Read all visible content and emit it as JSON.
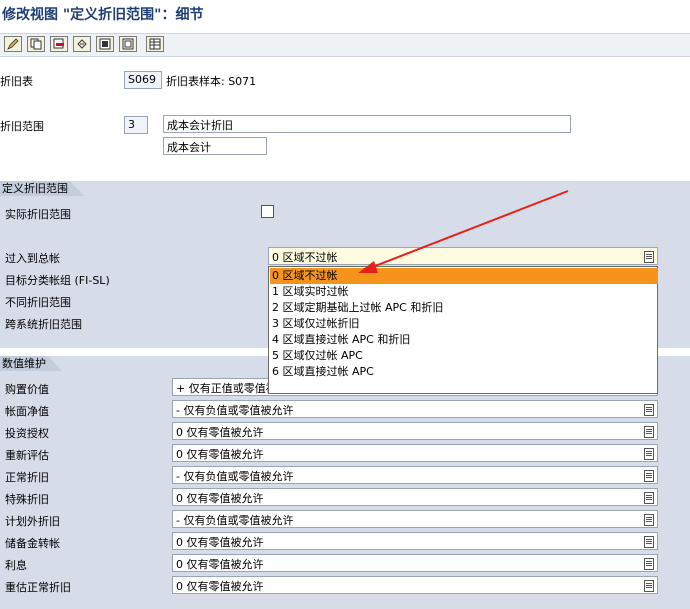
{
  "window": {
    "title": "修改视图 \"定义折旧范围\"：细节"
  },
  "toolbar": {
    "icons": [
      "edit-icon",
      "copy-icon",
      "delete-icon",
      "undo-icon",
      "select-all-icon",
      "deselect-all-icon",
      "table-icon"
    ]
  },
  "header": {
    "chart_label": "折旧表",
    "chart_value": "S069",
    "chart_desc": "折旧表样本: S071",
    "area_label": "折旧范围",
    "area_value": "3",
    "area_name": "成本会计折旧",
    "area_short": "成本会计"
  },
  "section_define": {
    "title": "定义折旧范围",
    "real_area_label": "实际折旧范围",
    "real_area_checked": false,
    "posting_label": "过入到总帐",
    "posting_value": "0 区域不过帐",
    "target_group_label": "目标分类帐组 (FI-SL)",
    "diff_area_label": "不同折旧范围",
    "cross_system_label": "跨系统折旧范围"
  },
  "dropdown": {
    "selected_index": 0,
    "options": [
      "0 区域不过帐",
      "1 区域实时过帐",
      "2 区域定期基础上过帐 APC 和折旧",
      "3 区域仅过帐折旧",
      "4 区域直接过帐 APC 和折旧",
      "5 区域仅过帐 APC",
      "6 区域直接过帐 APC"
    ]
  },
  "section_values": {
    "title": "数值维护",
    "rows": [
      {
        "label": "购置价值",
        "value": "+ 仅有正值或零值被允许"
      },
      {
        "label": "帐面净值",
        "value": "- 仅有负值或零值被允许"
      },
      {
        "label": "投资授权",
        "value": "0 仅有零值被允许"
      },
      {
        "label": "重新评估",
        "value": "0 仅有零值被允许"
      },
      {
        "label": "正常折旧",
        "value": "- 仅有负值或零值被允许"
      },
      {
        "label": "特殊折旧",
        "value": "0 仅有零值被允许"
      },
      {
        "label": "计划外折旧",
        "value": "- 仅有负值或零值被允许"
      },
      {
        "label": "储备金转帐",
        "value": "0 仅有零值被允许"
      },
      {
        "label": "利息",
        "value": "0 仅有零值被允许"
      },
      {
        "label": "重估正常折旧",
        "value": "0 仅有零值被允许"
      }
    ]
  },
  "colors": {
    "selection": "#f4941b",
    "arrow": "#e8201a",
    "section_bg": "#d6dce8"
  }
}
